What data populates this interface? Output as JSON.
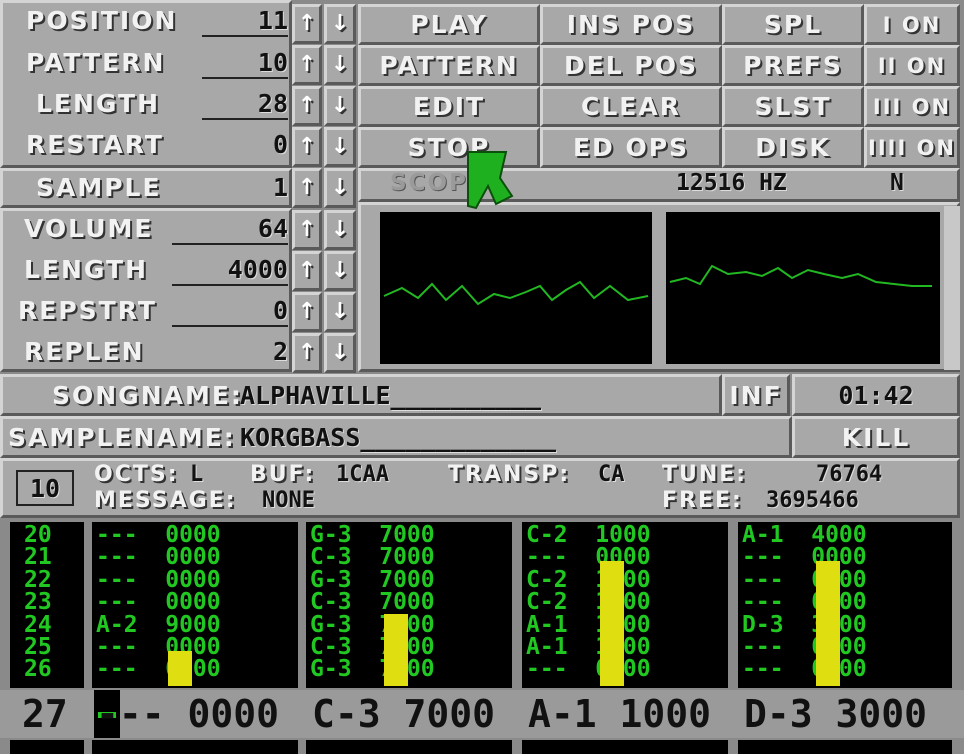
{
  "song_params": {
    "position": {
      "label": "POSITION",
      "value": "11"
    },
    "pattern": {
      "label": "PATTERN",
      "value": "10"
    },
    "length": {
      "label": "LENGTH",
      "value": "28"
    },
    "restart": {
      "label": "RESTART",
      "value": "0"
    }
  },
  "buttons": {
    "play": "PLAY",
    "pattern": "PATTERN",
    "edit": "EDIT",
    "stop": "STOP",
    "ins_pos": "INS POS",
    "del_pos": "DEL POS",
    "clear": "CLEAR",
    "ed_ops": "ED OPS",
    "spl": "SPL",
    "prefs": "PREFS",
    "slst": "SLST",
    "disk": "DISK",
    "ch1": "I ON",
    "ch2": "II ON",
    "ch3": "III ON",
    "ch4": "IIII ON"
  },
  "sample_params": {
    "sample": {
      "label": "SAMPLE",
      "value": "1"
    },
    "volume": {
      "label": "VOLUME",
      "value": "64"
    },
    "length": {
      "label": "LENGTH",
      "value": "4000"
    },
    "repstrt": {
      "label": "REPSTRT",
      "value": "0"
    },
    "replen": {
      "label": "REPLEN",
      "value": "2"
    }
  },
  "scope": {
    "label": "SCOPE",
    "freq": "12516 HZ",
    "mode": "N"
  },
  "songname": {
    "label": "SONGNAME:",
    "value": "ALPHAVILLE__________"
  },
  "inf_button": "INF",
  "time": "01:42",
  "samplename": {
    "label": "SAMPLENAME:",
    "value": "KORGBASS_____________"
  },
  "kill_button": "KILL",
  "status": {
    "pattern_num": "10",
    "octs_label": "OCTS:",
    "octs": "L",
    "buf_label": "BUF:",
    "buf": "1CAA",
    "transp_label": "TRANSP:",
    "transp": "CA",
    "tune_label": "TUNE:",
    "tune": "76764",
    "message_label": "MESSAGE:",
    "message": "NONE",
    "free_label": "FREE:",
    "free": "3695466"
  },
  "tracker": {
    "row_numbers": [
      "20",
      "21",
      "22",
      "23",
      "24",
      "25",
      "26"
    ],
    "channels": [
      {
        "rows": [
          "--- 0000",
          "--- 0000",
          "--- 0000",
          "--- 0000",
          "A-2 9000",
          "--- 0000",
          "--- 0000"
        ],
        "vu": 0.22
      },
      {
        "rows": [
          "G-3 7000",
          "C-3 7000",
          "G-3 7000",
          "C-3 7000",
          "G-3 7000",
          "C-3 7000",
          "G-3 7000"
        ],
        "vu": 0.45
      },
      {
        "rows": [
          "C-2 1000",
          "--- 0000",
          "C-2 1000",
          "C-2 1000",
          "A-1 1000",
          "A-1 1000",
          "--- 0000"
        ],
        "vu": 0.78
      },
      {
        "rows": [
          "A-1 4000",
          "--- 0000",
          "--- 0000",
          "--- 0000",
          "D-3 3000",
          "--- 0000",
          "--- 0000"
        ],
        "vu": 0.78
      }
    ],
    "current_row": {
      "number": "27",
      "cells": [
        "--- 0000",
        "C-3 7000",
        "A-1 1000",
        "D-3 3000"
      ]
    }
  },
  "icons": {
    "up": "arrow-up-icon",
    "down": "arrow-down-icon",
    "cursor": "pointer-icon"
  }
}
